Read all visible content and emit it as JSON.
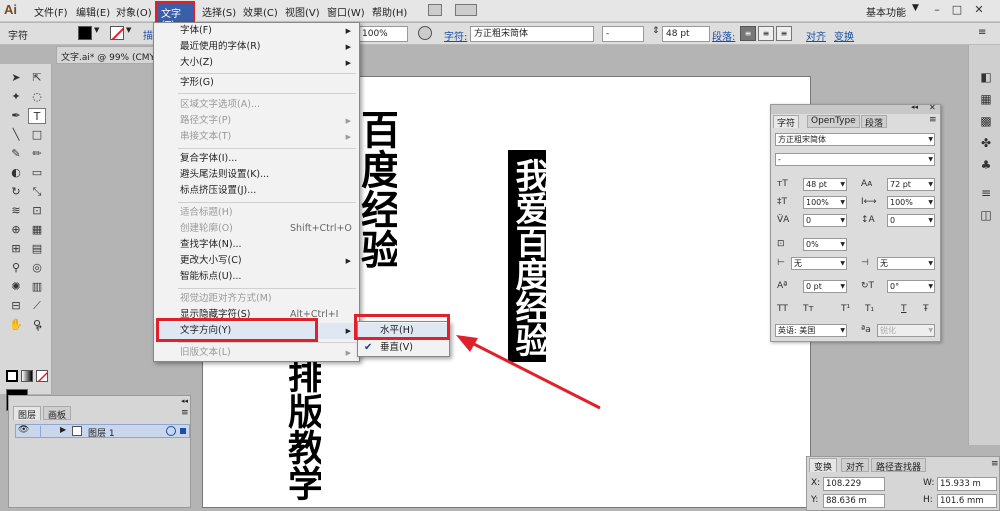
{
  "app": {
    "logo": "Ai",
    "workspace": "基本功能"
  },
  "menubar": {
    "items": [
      "文件(F)",
      "编辑(E)",
      "对象(O)",
      "文字(T)",
      "选择(S)",
      "效果(C)",
      "视图(V)",
      "窗口(W)",
      "帮助(H)"
    ],
    "active_index": 3
  },
  "controlbar": {
    "mode_label": "字符",
    "partial_label": "描",
    "zoom": "100%",
    "font_label": "字符:",
    "font_name": "方正粗宋简体",
    "font_style": "-",
    "font_size": "48 pt",
    "paragraph_label": "段落:",
    "align_link": "对齐",
    "transform_link": "变换"
  },
  "document": {
    "tab_title": "文字.ai* @ 99% (CMYK"
  },
  "canvas": {
    "vertical_text_white": "我爱百度经验",
    "vertical_text_top": "百度经验",
    "vertical_text_bottom": "排版教学"
  },
  "text_menu": {
    "items": [
      {
        "label": "字体(F)",
        "shortcut": "",
        "submenu": true,
        "disabled": false
      },
      {
        "label": "最近使用的字体(R)",
        "shortcut": "",
        "submenu": true,
        "disabled": false
      },
      {
        "label": "大小(Z)",
        "shortcut": "",
        "submenu": true,
        "disabled": false
      },
      {
        "label": "字形(G)",
        "shortcut": "",
        "submenu": false,
        "disabled": false
      },
      {
        "label": "区域文字选项(A)...",
        "shortcut": "",
        "submenu": false,
        "disabled": true
      },
      {
        "label": "路径文字(P)",
        "shortcut": "",
        "submenu": true,
        "disabled": true
      },
      {
        "label": "串接文本(T)",
        "shortcut": "",
        "submenu": true,
        "disabled": true
      },
      {
        "label": "复合字体(I)...",
        "shortcut": "",
        "submenu": false,
        "disabled": false
      },
      {
        "label": "避头尾法则设置(K)...",
        "shortcut": "",
        "submenu": false,
        "disabled": false
      },
      {
        "label": "标点挤压设置(J)...",
        "shortcut": "",
        "submenu": false,
        "disabled": false
      },
      {
        "label": "适合标题(H)",
        "shortcut": "",
        "submenu": false,
        "disabled": true
      },
      {
        "label": "创建轮廓(O)",
        "shortcut": "Shift+Ctrl+O",
        "submenu": false,
        "disabled": true
      },
      {
        "label": "查找字体(N)...",
        "shortcut": "",
        "submenu": false,
        "disabled": false
      },
      {
        "label": "更改大小写(C)",
        "shortcut": "",
        "submenu": true,
        "disabled": false
      },
      {
        "label": "智能标点(U)...",
        "shortcut": "",
        "submenu": false,
        "disabled": false
      },
      {
        "label": "视觉边距对齐方式(M)",
        "shortcut": "",
        "submenu": false,
        "disabled": true
      },
      {
        "label": "显示隐藏字符(S)",
        "shortcut": "Alt+Ctrl+I",
        "submenu": false,
        "disabled": false
      },
      {
        "label": "文字方向(Y)",
        "shortcut": "",
        "submenu": true,
        "disabled": false
      },
      {
        "label": "旧版文本(L)",
        "shortcut": "",
        "submenu": true,
        "disabled": true
      }
    ]
  },
  "direction_submenu": {
    "items": [
      {
        "label": "水平(H)",
        "checked": false
      },
      {
        "label": "垂直(V)",
        "checked": true
      }
    ]
  },
  "layers_panel": {
    "tabs": [
      "图层",
      "画板"
    ],
    "layer_name": "图层 1"
  },
  "character_panel": {
    "tabs": [
      "字符",
      "OpenType",
      "段落"
    ],
    "font_name": "方正粗宋简体",
    "font_style": "-",
    "font_size": "48 pt",
    "leading": "72 pt",
    "vertical_scale": "100%",
    "horizontal_scale": "100%",
    "kerning": "0",
    "tracking": "0",
    "tsume": "0%",
    "aki_left": "无",
    "aki_right": "无",
    "baseline_shift": "0 pt",
    "rotation": "0°",
    "style_buttons": [
      "TT",
      "Tт",
      "T¹",
      "T₁",
      "T",
      "Ŧ"
    ],
    "language": "英语: 美国",
    "antialias": "锐化",
    "aa_label": "ªa"
  },
  "transform_panel": {
    "tabs": [
      "变换",
      "对齐",
      "路径查找器"
    ],
    "x_value": "108.229",
    "w_value": "15.933 m",
    "y_value": "88.636 m",
    "h_value": "101.6 mm"
  }
}
